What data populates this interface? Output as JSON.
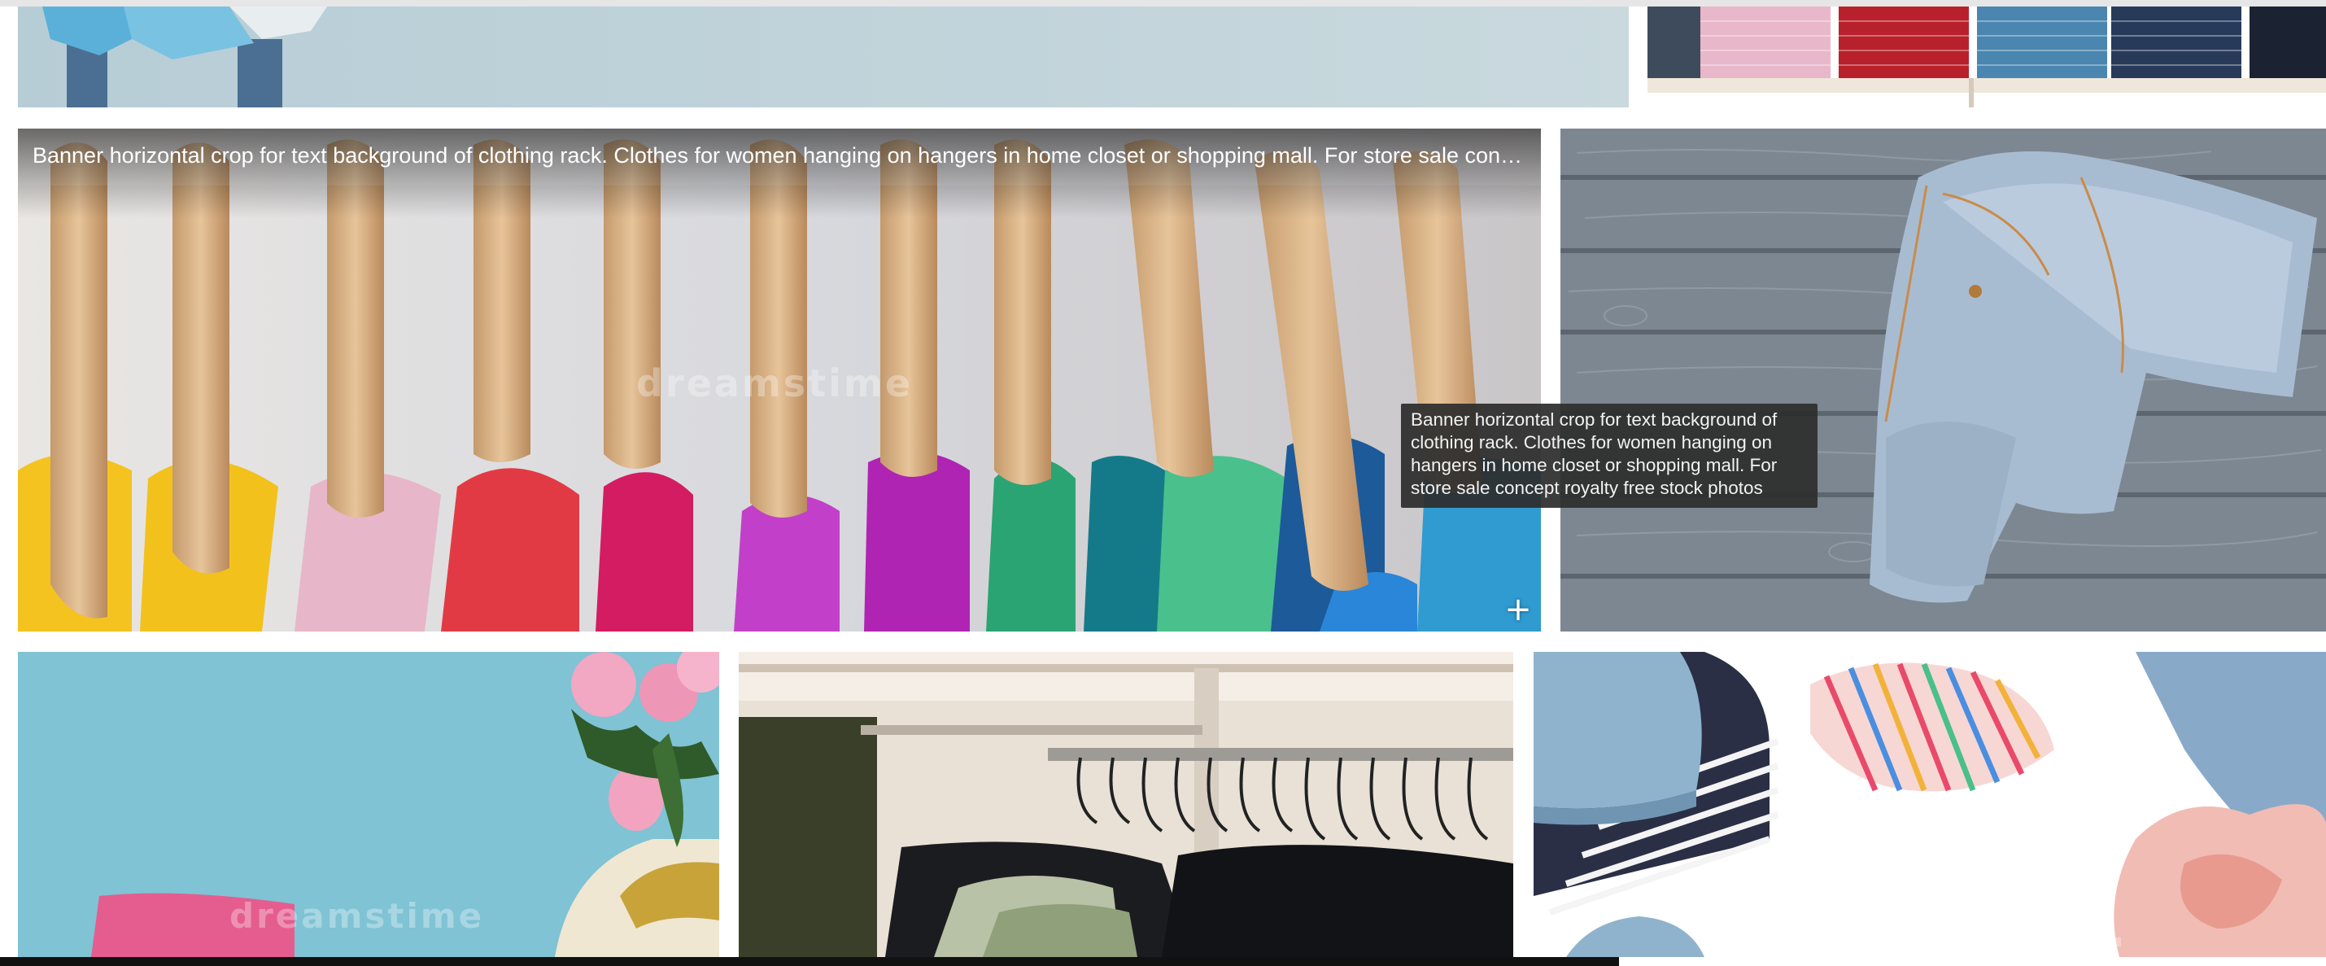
{
  "gallery": {
    "featured": {
      "caption": "Banner horizontal crop for text background of clothing rack. Clothes for women hanging on hangers in home closet or shopping mall. For store sale concept royalty free stock photos",
      "tooltip": "Banner horizontal crop for text background of clothing rack. Clothes for women hanging on hangers in home closet or shopping mall. For store sale concept royalty free stock photos",
      "add_icon": "plus-icon",
      "add_symbol": "+"
    },
    "watermark": "dreamstime",
    "watermark_large": "dreamstime."
  }
}
